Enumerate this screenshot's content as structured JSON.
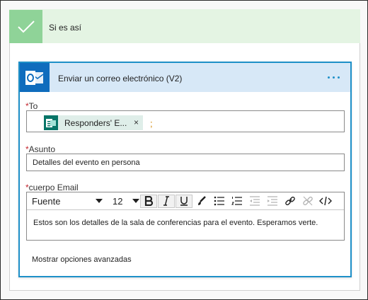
{
  "condition": {
    "title": "Si es así"
  },
  "action": {
    "title": "Enviar un correo electrónico (V2)",
    "icon": "outlook-icon"
  },
  "to": {
    "label": "To",
    "required_mark": "*",
    "token_label": "Responders' E...",
    "token_icon": "forms-icon",
    "token_close": "×",
    "separator": ";"
  },
  "subject": {
    "label": "Asunto",
    "required_mark": "*",
    "value": "Detalles del evento en persona"
  },
  "body": {
    "label": "cuerpo Email",
    "required_mark": "*",
    "font": "Fuente",
    "size": "12",
    "content": "Estos son los detalles de la sala de conferencias para el evento. Esperamos verte."
  },
  "advanced_options": "Mostrar opciones avanzadas",
  "colors": {
    "condition_header": "#e4f4e3",
    "check_tile": "#8fd398",
    "action_header": "#d7e8f7",
    "action_border": "#1e90c8",
    "outlook_blue": "#0f6cbd",
    "forms_green": "#077568",
    "required": "#c4262e"
  }
}
